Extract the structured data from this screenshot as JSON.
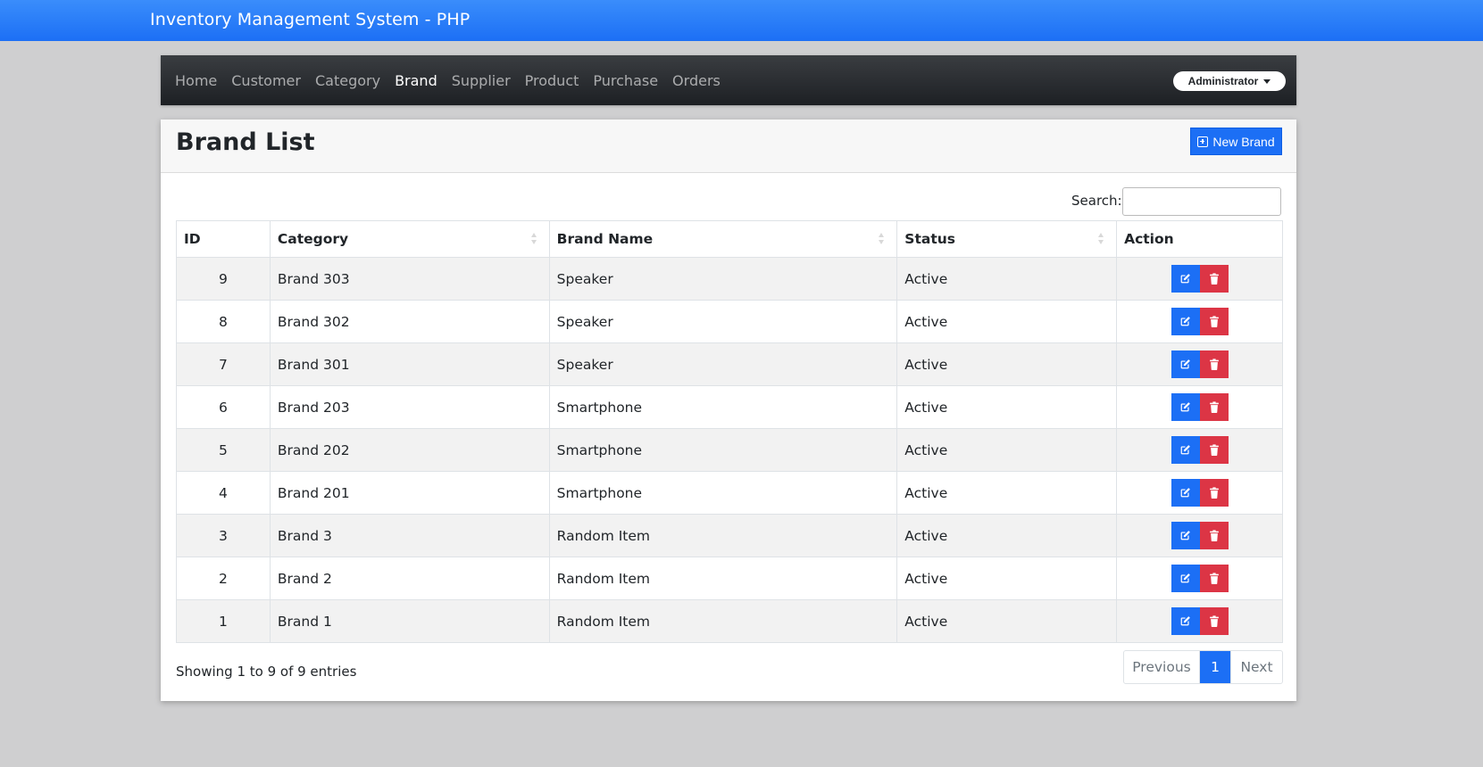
{
  "app": {
    "title": "Inventory Management System - PHP"
  },
  "nav": {
    "items": [
      {
        "label": "Home",
        "active": false
      },
      {
        "label": "Customer",
        "active": false
      },
      {
        "label": "Category",
        "active": false
      },
      {
        "label": "Brand",
        "active": true
      },
      {
        "label": "Supplier",
        "active": false
      },
      {
        "label": "Product",
        "active": false
      },
      {
        "label": "Purchase",
        "active": false
      },
      {
        "label": "Orders",
        "active": false
      }
    ],
    "user_label": "Administrator"
  },
  "page": {
    "title": "Brand List",
    "new_button_label": "New Brand",
    "new_button_icon": "plus-square-icon"
  },
  "search": {
    "label": "Search:",
    "value": ""
  },
  "table": {
    "columns": [
      {
        "label": "ID",
        "sortable": false
      },
      {
        "label": "Category",
        "sortable": true
      },
      {
        "label": "Brand Name",
        "sortable": true
      },
      {
        "label": "Status",
        "sortable": true
      },
      {
        "label": "Action",
        "sortable": false
      }
    ],
    "rows": [
      {
        "id": "9",
        "category": "Brand 303",
        "brand": "Speaker",
        "status": "Active"
      },
      {
        "id": "8",
        "category": "Brand 302",
        "brand": "Speaker",
        "status": "Active"
      },
      {
        "id": "7",
        "category": "Brand 301",
        "brand": "Speaker",
        "status": "Active"
      },
      {
        "id": "6",
        "category": "Brand 203",
        "brand": "Smartphone",
        "status": "Active"
      },
      {
        "id": "5",
        "category": "Brand 202",
        "brand": "Smartphone",
        "status": "Active"
      },
      {
        "id": "4",
        "category": "Brand 201",
        "brand": "Smartphone",
        "status": "Active"
      },
      {
        "id": "3",
        "category": "Brand 3",
        "brand": "Random Item",
        "status": "Active"
      },
      {
        "id": "2",
        "category": "Brand 2",
        "brand": "Random Item",
        "status": "Active"
      },
      {
        "id": "1",
        "category": "Brand 1",
        "brand": "Random Item",
        "status": "Active"
      }
    ],
    "row_actions": [
      {
        "icon": "edit-icon",
        "color": "#1c6ff5"
      },
      {
        "icon": "trash-icon",
        "color": "#dc3545"
      }
    ]
  },
  "footer": {
    "info": "Showing 1 to 9 of 9 entries",
    "pagination": {
      "previous": "Previous",
      "current": "1",
      "next": "Next"
    }
  },
  "colors": {
    "primary": "#1c6ff5",
    "danger": "#dc3545",
    "navbar": "#2b2e32"
  }
}
